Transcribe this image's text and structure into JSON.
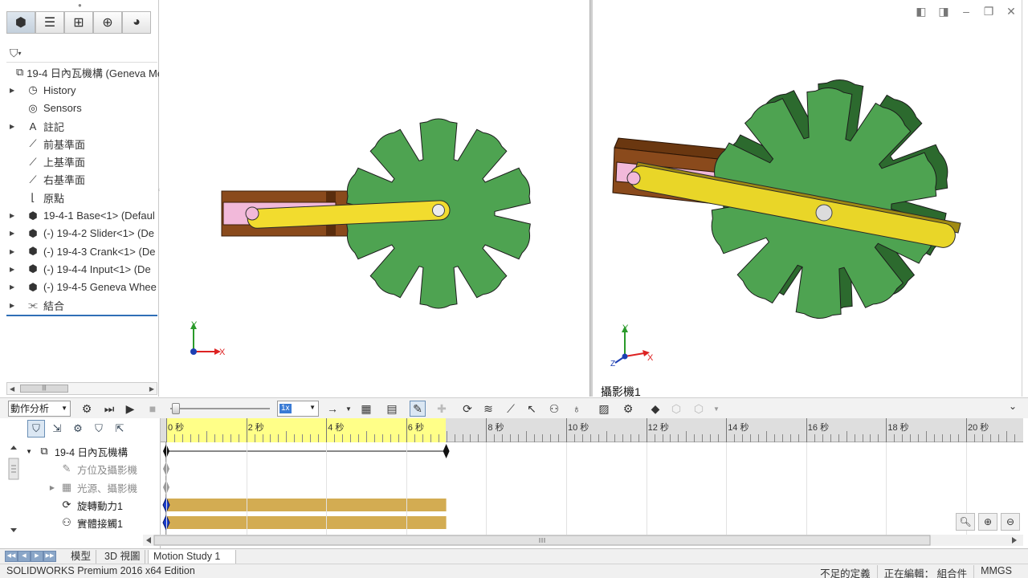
{
  "fm": {
    "tabs": [
      {
        "name": "feature-manager-tab",
        "icon": "cube-icon"
      },
      {
        "name": "property-manager-tab",
        "icon": "list-icon"
      },
      {
        "name": "configuration-manager-tab",
        "icon": "config-icon"
      },
      {
        "name": "dimxpert-tab",
        "icon": "crosshair-icon"
      },
      {
        "name": "display-manager-tab",
        "icon": "color-wheel-icon"
      }
    ],
    "tree": [
      {
        "label": "19-4 日內瓦機構  (Geneva Me",
        "icon": "assembly-icon",
        "arrow": false,
        "root": true
      },
      {
        "label": "History",
        "icon": "history-icon",
        "arrow": true
      },
      {
        "label": "Sensors",
        "icon": "sensor-icon",
        "arrow": false
      },
      {
        "label": "註記",
        "icon": "annotation-icon",
        "arrow": true
      },
      {
        "label": "前基準面",
        "icon": "plane-icon",
        "arrow": false
      },
      {
        "label": "上基準面",
        "icon": "plane-icon",
        "arrow": false
      },
      {
        "label": "右基準面",
        "icon": "plane-icon",
        "arrow": false
      },
      {
        "label": "原點",
        "icon": "origin-icon",
        "arrow": false
      },
      {
        "label": "19-4-1 Base<1> (Defaul",
        "icon": "part-icon",
        "arrow": true
      },
      {
        "label": "(-) 19-4-2 Slider<1> (De",
        "icon": "part-icon",
        "arrow": true
      },
      {
        "label": "(-) 19-4-3 Crank<1> (De",
        "icon": "part-icon",
        "arrow": true
      },
      {
        "label": "(-) 19-4-4 Input<1> (De",
        "icon": "part-icon",
        "arrow": true
      },
      {
        "label": "(-) 19-4-5 Geneva Whee",
        "icon": "part-icon",
        "arrow": true
      },
      {
        "label": "結合",
        "icon": "mates-icon",
        "arrow": true
      }
    ]
  },
  "viewport": {
    "camera_label": "攝影機1",
    "axis_x": "X",
    "axis_y": "Y",
    "axis_z": "Z"
  },
  "motion": {
    "study_type": "動作分析",
    "playback_speed": "1x",
    "tree": [
      {
        "label": "19-4 日內瓦機構",
        "icon": "assembly-icon",
        "dim": false,
        "arrow": "down"
      },
      {
        "label": "方位及攝影機",
        "icon": "camera-icon",
        "dim": true,
        "arrow": ""
      },
      {
        "label": "光源、攝影機",
        "icon": "lights-icon",
        "dim": true,
        "arrow": "right"
      },
      {
        "label": "旋轉動力1",
        "icon": "motor-icon",
        "dim": false,
        "arrow": ""
      },
      {
        "label": "實體接觸1",
        "icon": "contact-icon",
        "dim": false,
        "arrow": ""
      }
    ],
    "timeline": {
      "unit": "秒",
      "ticks": [
        "0 秒",
        "2 秒",
        "4 秒",
        "6 秒",
        "8 秒",
        "10 秒",
        "12 秒",
        "14 秒",
        "16 秒",
        "18 秒",
        "20 秒"
      ],
      "duration_s": 7
    }
  },
  "tabs": {
    "model": "模型",
    "view3d": "3D 視圖",
    "motion_study": "Motion Study 1"
  },
  "status": {
    "product": "SOLIDWORKS Premium 2016 x64 Edition",
    "definition": "不足的定義",
    "editing": "正在編輯：  組合件",
    "units": "MMGS"
  },
  "colors": {
    "gear": "#4ea351",
    "crank": "#f2dc2e",
    "slider": "#f2b9da",
    "base": "#8a4a1c",
    "timeline_active": "#ffff88",
    "motor_bar": "#d3ac52"
  }
}
